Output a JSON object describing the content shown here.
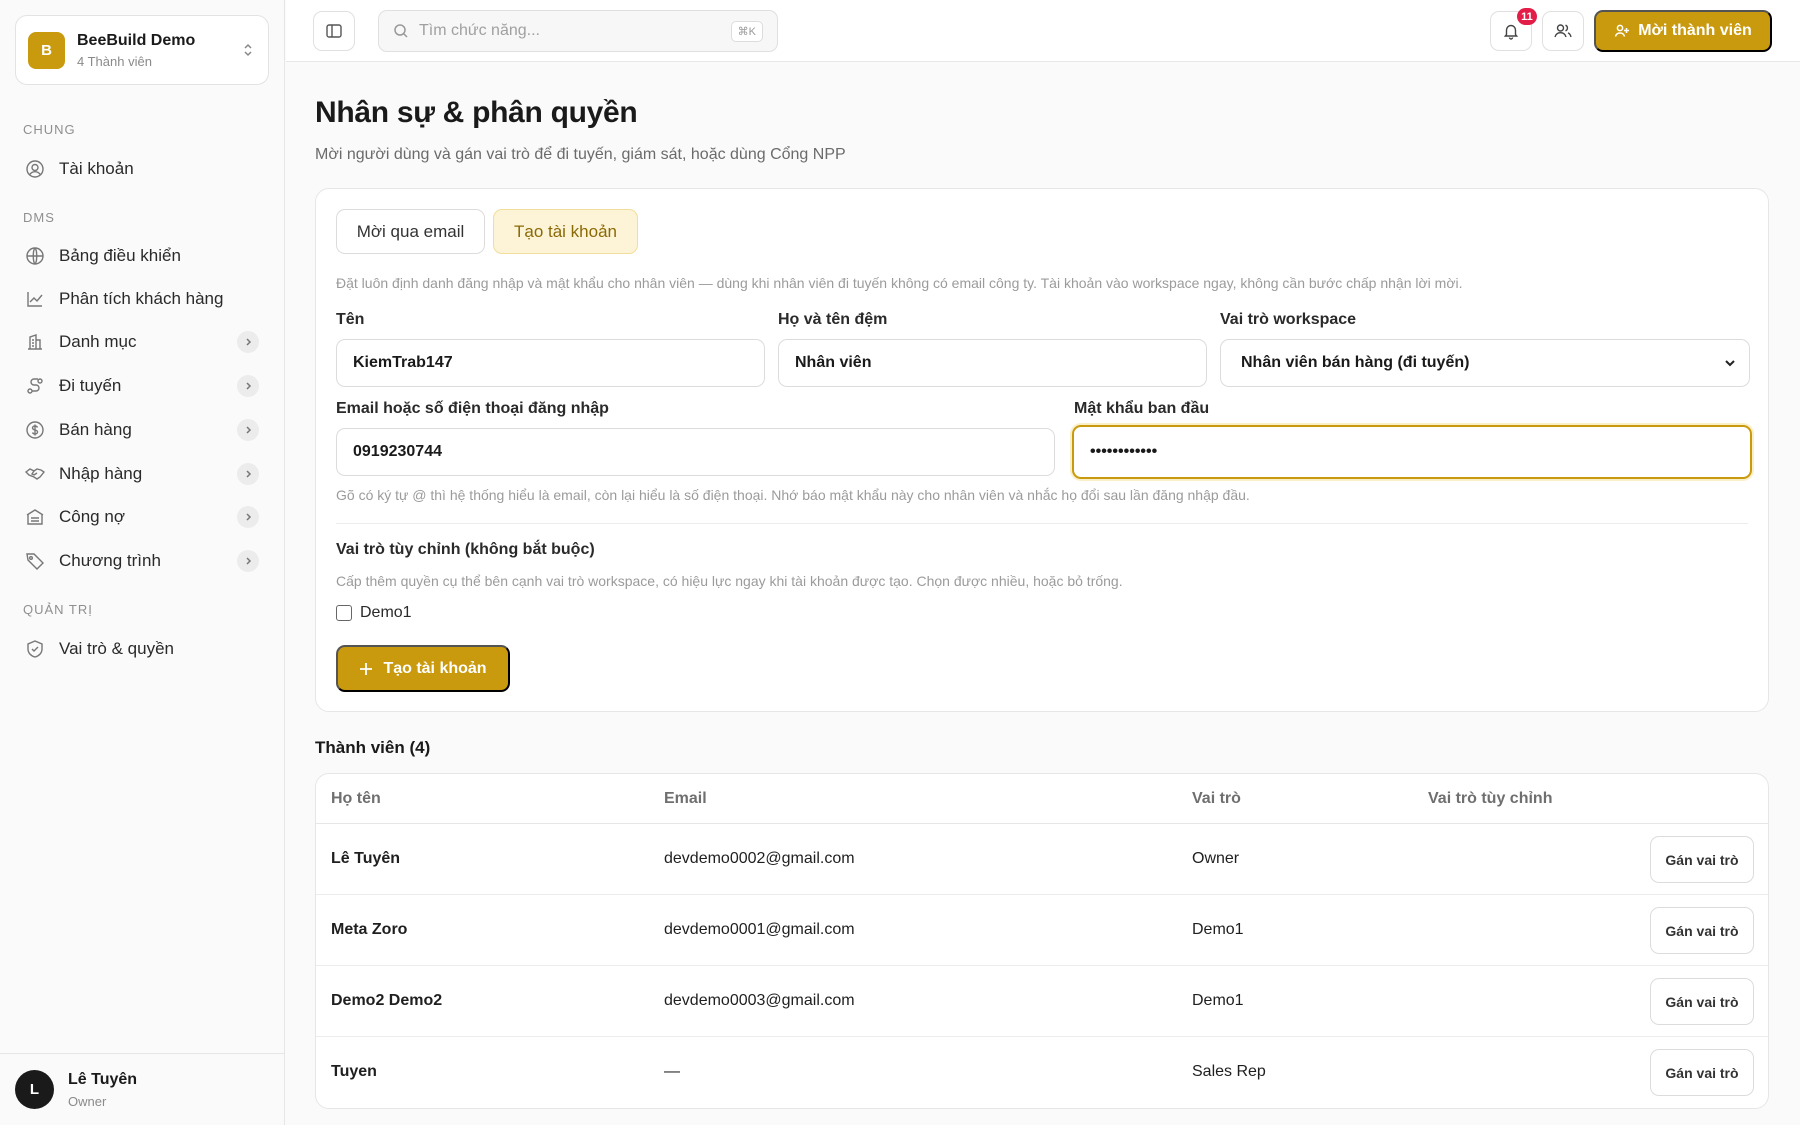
{
  "workspace": {
    "initial": "B",
    "name": "BeeBuild Demo",
    "members": "4 Thành viên"
  },
  "sidebar": {
    "sections": [
      {
        "label": "CHUNG"
      },
      {
        "label": "DMS"
      },
      {
        "label": "QUẢN TRỊ"
      }
    ],
    "items": [
      {
        "label": "Tài khoản",
        "icon": "user-circle-icon"
      },
      {
        "label": "Bảng điều khiển",
        "icon": "globe-icon"
      },
      {
        "label": "Phân tích khách hàng",
        "icon": "trend-chart-icon"
      },
      {
        "label": "Danh mục",
        "icon": "building-icon"
      },
      {
        "label": "Đi tuyến",
        "icon": "route-icon"
      },
      {
        "label": "Bán hàng",
        "icon": "dollar-circle-icon"
      },
      {
        "label": "Nhập hàng",
        "icon": "handshake-icon"
      },
      {
        "label": "Công nợ",
        "icon": "ledger-icon"
      },
      {
        "label": "Chương trình",
        "icon": "tag-icon"
      },
      {
        "label": "Vai trò & quyền",
        "icon": "shield-icon"
      }
    ]
  },
  "user": {
    "initial": "L",
    "name": "Lê Tuyên",
    "role": "Owner"
  },
  "topbar": {
    "search_placeholder": "Tìm chức năng...",
    "shortcut": "⌘K",
    "notifications": "11",
    "invite_label": "Mời thành viên"
  },
  "page": {
    "title": "Nhân sự & phân quyền",
    "subtitle": "Mời người dùng và gán vai trò để đi tuyến, giám sát, hoặc dùng Cổng NPP"
  },
  "form": {
    "tabs": [
      {
        "label": "Mời qua email"
      },
      {
        "label": "Tạo tài khoản",
        "active": true
      }
    ],
    "intro": "Đặt luôn định danh đăng nhập và mật khẩu cho nhân viên — dùng khi nhân viên đi tuyến không có email công ty. Tài khoản vào workspace ngay, không cần bước chấp nhận lời mời.",
    "first_name_label": "Tên",
    "first_name_value": "KiemTrab147",
    "last_name_label": "Họ và tên đệm",
    "last_name_value": "Nhân viên",
    "role_label": "Vai trò workspace",
    "role_value": "Nhân viên bán hàng (đi tuyến)",
    "login_label": "Email hoặc số điện thoại đăng nhập",
    "login_value": "0919230744",
    "password_label": "Mật khẩu ban đầu",
    "password_value": "••••••••••••",
    "login_hint": "Gõ có ký tự @ thì hệ thống hiểu là email, còn lại hiểu là số điện thoại. Nhớ báo mật khẩu này cho nhân viên và nhắc họ đổi sau lần đăng nhập đầu.",
    "custom_role_title": "Vai trò tùy chỉnh (không bắt buộc)",
    "custom_role_hint": "Cấp thêm quyền cụ thể bên cạnh vai trò workspace, có hiệu lực ngay khi tài khoản được tạo. Chọn được nhiều, hoặc bỏ trống.",
    "custom_role_option": "Demo1",
    "submit_label": "Tạo tài khoản"
  },
  "members": {
    "title": "Thành viên (4)",
    "columns": [
      "Họ tên",
      "Email",
      "Vai trò",
      "Vai trò tùy chỉnh"
    ],
    "assign_label": "Gán vai trò",
    "rows": [
      {
        "name": "Lê Tuyên",
        "email": "devdemo0002@gmail.com",
        "role": "Owner"
      },
      {
        "name": "Meta Zoro",
        "email": "devdemo0001@gmail.com",
        "role": "Demo1"
      },
      {
        "name": "Demo2 Demo2",
        "email": "devdemo0003@gmail.com",
        "role": "Demo1"
      },
      {
        "name": "Tuyen",
        "email": "—",
        "role": "Sales Rep"
      }
    ]
  },
  "colors": {
    "accent": "#c99a0d",
    "accent_soft": "#fdf4d8",
    "badge": "#e11d48"
  }
}
